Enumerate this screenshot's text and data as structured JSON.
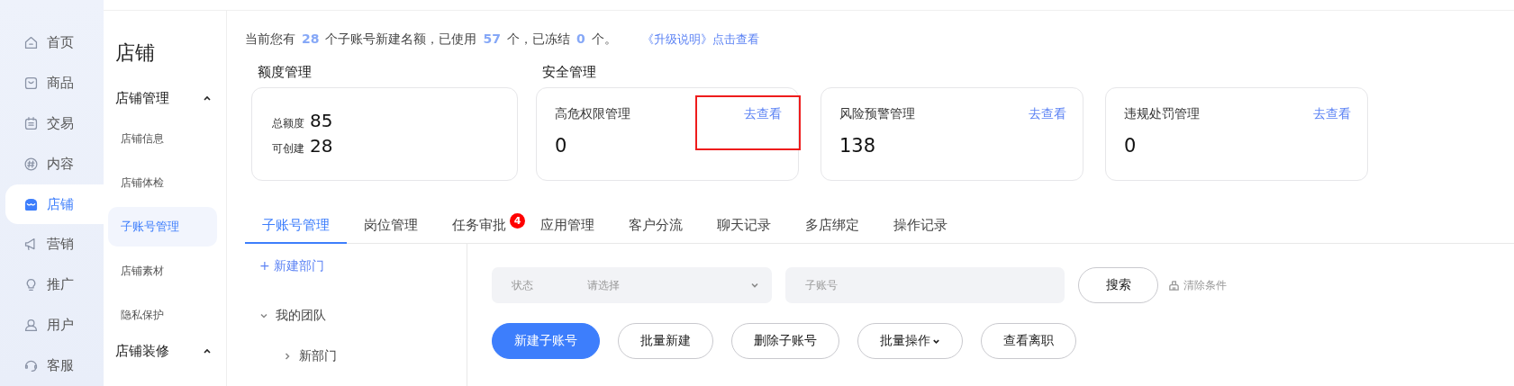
{
  "nav": [
    {
      "label": "首页",
      "selected": false
    },
    {
      "label": "商品",
      "selected": false
    },
    {
      "label": "交易",
      "selected": false
    },
    {
      "label": "内容",
      "selected": false
    },
    {
      "label": "店铺",
      "selected": true
    },
    {
      "label": "营销",
      "selected": false
    },
    {
      "label": "推广",
      "selected": false
    },
    {
      "label": "用户",
      "selected": false
    },
    {
      "label": "客服",
      "selected": false
    }
  ],
  "sidebar": {
    "title": "店铺",
    "groups": [
      {
        "label": "店铺管理",
        "expanded": true,
        "items": [
          {
            "label": "店铺信息",
            "selected": false
          },
          {
            "label": "店铺体检",
            "selected": false
          },
          {
            "label": "子账号管理",
            "selected": true
          },
          {
            "label": "店铺素材",
            "selected": false
          },
          {
            "label": "隐私保护",
            "selected": false
          }
        ]
      },
      {
        "label": "店铺装修",
        "expanded": true
      }
    ]
  },
  "notice": {
    "parts": [
      "当前您有",
      "28",
      "个子账号新建名额，已使用",
      "57",
      "个，已冻结",
      "0",
      "个。"
    ],
    "link": "《升级说明》点击查看"
  },
  "quota": {
    "title": "额度管理",
    "rows": [
      {
        "label": "总额度",
        "value": "85"
      },
      {
        "label": "可创建",
        "value": "28"
      }
    ]
  },
  "security": {
    "title": "安全管理",
    "cards": [
      {
        "title": "高危权限管理",
        "link": "去查看",
        "value": "0",
        "highlighted": true
      },
      {
        "title": "风险预警管理",
        "link": "去查看",
        "value": "138",
        "highlighted": false
      },
      {
        "title": "违规处罚管理",
        "link": "去查看",
        "value": "0",
        "highlighted": false
      }
    ]
  },
  "tabs": [
    {
      "label": "子账号管理",
      "selected": true
    },
    {
      "label": "岗位管理",
      "selected": false
    },
    {
      "label": "任务审批",
      "selected": false,
      "badge": "4"
    },
    {
      "label": "应用管理",
      "selected": false
    },
    {
      "label": "客户分流",
      "selected": false
    },
    {
      "label": "聊天记录",
      "selected": false
    },
    {
      "label": "多店绑定",
      "selected": false
    },
    {
      "label": "操作记录",
      "selected": false
    }
  ],
  "tree": {
    "add": "+ 新建部门",
    "nodes": [
      {
        "label": "我的团队",
        "expanded": true,
        "children": [
          {
            "label": "新部门",
            "expanded": false
          }
        ]
      }
    ]
  },
  "filters": {
    "status_label": "状态",
    "status_placeholder": "请选择",
    "account_placeholder": "子账号",
    "search": "搜索",
    "clear": "清除条件"
  },
  "actions": [
    {
      "label": "新建子账号",
      "kind": "primary"
    },
    {
      "label": "批量新建",
      "kind": "plain"
    },
    {
      "label": "删除子账号",
      "kind": "plain"
    },
    {
      "label": "批量操作",
      "kind": "dropdown"
    },
    {
      "label": "查看离职",
      "kind": "plain"
    }
  ]
}
